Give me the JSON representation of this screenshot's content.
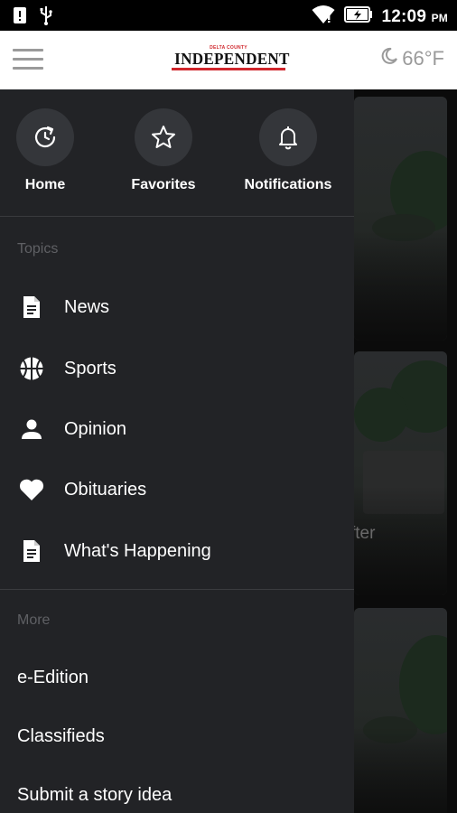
{
  "status_bar": {
    "time": "12:09",
    "ampm": "PM",
    "icons": [
      "alert-icon",
      "usb-icon",
      "wifi-icon",
      "battery-charging-icon"
    ]
  },
  "header": {
    "logo_small": "DELTA COUNTY",
    "logo_main": "INDEPENDENT",
    "weather_temp": "66°F",
    "weather_icon": "moon-icon",
    "colors": {
      "brand_red": "#d0262c"
    }
  },
  "drawer": {
    "quick_actions": [
      {
        "label": "Home",
        "icon": "home-refresh-icon"
      },
      {
        "label": "Favorites",
        "icon": "star-icon"
      },
      {
        "label": "Notifications",
        "icon": "bell-icon"
      }
    ],
    "topics_heading": "Topics",
    "topics": [
      {
        "label": "News",
        "icon": "document-icon"
      },
      {
        "label": "Sports",
        "icon": "basketball-icon"
      },
      {
        "label": "Opinion",
        "icon": "person-icon"
      },
      {
        "label": "Obituaries",
        "icon": "heart-icon"
      },
      {
        "label": "What's Happening",
        "icon": "document-icon"
      }
    ],
    "more_heading": "More",
    "more": [
      {
        "label": "e-Edition"
      },
      {
        "label": "Classifieds"
      },
      {
        "label": "Submit a story idea"
      }
    ]
  },
  "feed": {
    "partial_text": "fter"
  }
}
